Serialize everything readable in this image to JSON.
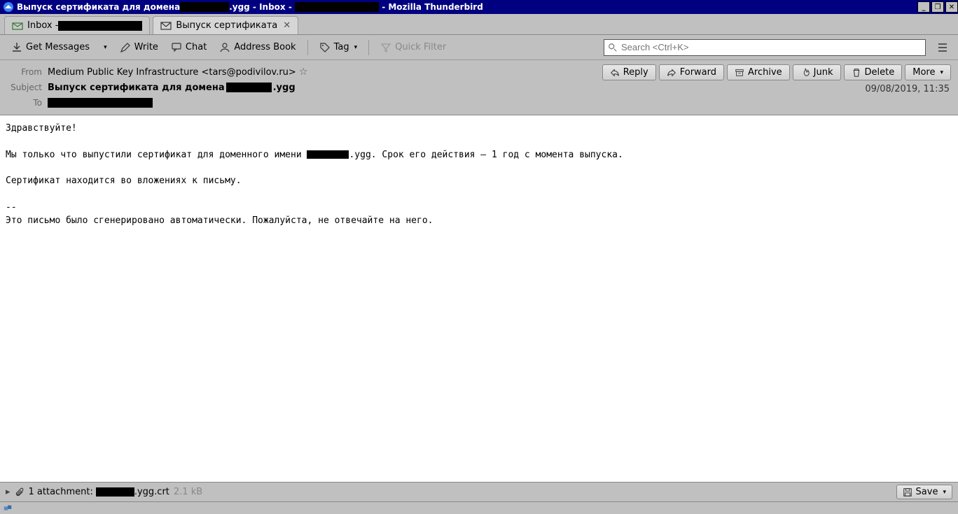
{
  "titlebar": {
    "prefix": "Выпуск сертификата для домена",
    "suffix1": ".ygg - Inbox - ",
    "suffix2": " - Mozilla Thunderbird"
  },
  "tabs": {
    "inbox_prefix": "Inbox - ",
    "message_tab": "Выпуск сертификата"
  },
  "toolbar": {
    "get_messages": "Get Messages",
    "write": "Write",
    "chat": "Chat",
    "address_book": "Address Book",
    "tag": "Tag",
    "quick_filter": "Quick Filter",
    "search_placeholder": "Search <Ctrl+K>"
  },
  "actions": {
    "reply": "Reply",
    "forward": "Forward",
    "archive": "Archive",
    "junk": "Junk",
    "delete": "Delete",
    "more": "More"
  },
  "header": {
    "from_label": "From",
    "from_value": "Medium Public Key Infrastructure <tars@podivilov.ru>",
    "subject_label": "Subject",
    "subject_prefix": "Выпуск сертификата для домена",
    "subject_suffix": ".ygg",
    "to_label": "To",
    "datetime": "09/08/2019, 11:35"
  },
  "body": {
    "line1": "Здравствуйте!",
    "line2a": "Мы только что выпустили сертификат для доменного имени ",
    "line2b": ".ygg. Срок его действия — 1 год с момента выпуска.",
    "line3": "Сертификат находится во вложениях к письму.",
    "line4": "--",
    "line5": "Это письмо было сгенерировано автоматически. Пожалуйста, не отвечайте на него."
  },
  "attach": {
    "label": "1 attachment:",
    "file_suffix": ".ygg.crt",
    "size": "2.1 kB",
    "save": "Save"
  }
}
